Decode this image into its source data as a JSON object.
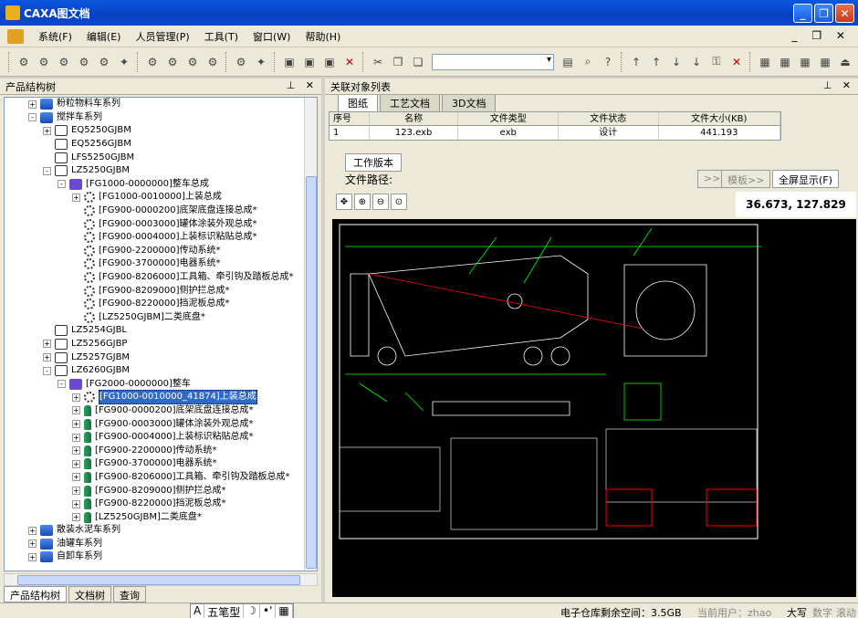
{
  "window": {
    "title": "CAXA图文档"
  },
  "menu": [
    "系统(F)",
    "编辑(E)",
    "人员管理(P)",
    "工具(T)",
    "窗口(W)",
    "帮助(H)"
  ],
  "left_panel": {
    "title": "产品结构树",
    "tree": [
      {
        "indent": 1,
        "exp": "+",
        "icon": "folder",
        "label": "粉粒物料车系列"
      },
      {
        "indent": 1,
        "exp": "-",
        "icon": "folder",
        "label": "搅拌车系列"
      },
      {
        "indent": 2,
        "exp": "+",
        "icon": "assy",
        "label": "EQ5250GJBM"
      },
      {
        "indent": 2,
        "exp": "",
        "icon": "assy",
        "label": "EQ5256GJBM"
      },
      {
        "indent": 2,
        "exp": "",
        "icon": "assy",
        "label": "LFS5250GJBM"
      },
      {
        "indent": 2,
        "exp": "-",
        "icon": "assy",
        "label": "LZ5250GJBM"
      },
      {
        "indent": 3,
        "exp": "-",
        "icon": "root",
        "label": "[FG1000-0000000]整车总成"
      },
      {
        "indent": 4,
        "exp": "+",
        "icon": "gear",
        "label": "[FG1000-0010000]上装总成"
      },
      {
        "indent": 4,
        "exp": "",
        "icon": "gear",
        "label": "[FG900-0000200]底架底盘连接总成*"
      },
      {
        "indent": 4,
        "exp": "",
        "icon": "gear",
        "label": "[FG900-0003000]罐体涂装外观总成*"
      },
      {
        "indent": 4,
        "exp": "",
        "icon": "gear",
        "label": "[FG900-0004000]上装标识粘贴总成*"
      },
      {
        "indent": 4,
        "exp": "",
        "icon": "gear",
        "label": "[FG900-2200000]传动系统*"
      },
      {
        "indent": 4,
        "exp": "",
        "icon": "gear",
        "label": "[FG900-3700000]电器系统*"
      },
      {
        "indent": 4,
        "exp": "",
        "icon": "gear",
        "label": "[FG900-8206000]工具箱、牵引钩及踏板总成*"
      },
      {
        "indent": 4,
        "exp": "",
        "icon": "gear",
        "label": "[FG900-8209000]侧护拦总成*"
      },
      {
        "indent": 4,
        "exp": "",
        "icon": "gear",
        "label": "[FG900-8220000]挡泥板总成*"
      },
      {
        "indent": 4,
        "exp": "",
        "icon": "gear",
        "label": "[LZ5250GJBM]二类底盘*"
      },
      {
        "indent": 2,
        "exp": "",
        "icon": "assy",
        "label": "LZ5254GJBL"
      },
      {
        "indent": 2,
        "exp": "+",
        "icon": "assy",
        "label": "LZ5256GJBP"
      },
      {
        "indent": 2,
        "exp": "+",
        "icon": "assy",
        "label": "LZ5257GJBM"
      },
      {
        "indent": 2,
        "exp": "-",
        "icon": "assy",
        "label": "LZ6260GJBM"
      },
      {
        "indent": 3,
        "exp": "-",
        "icon": "root",
        "label": "[FG2000-0000000]整车"
      },
      {
        "indent": 4,
        "exp": "+",
        "icon": "gear",
        "label": "[FG1000-0010000_41874]上装总成",
        "selected": true
      },
      {
        "indent": 4,
        "exp": "+",
        "icon": "pin",
        "label": "[FG900-0000200]底架底盘连接总成*"
      },
      {
        "indent": 4,
        "exp": "+",
        "icon": "pin",
        "label": "[FG900-0003000]罐体涂装外观总成*"
      },
      {
        "indent": 4,
        "exp": "+",
        "icon": "pin",
        "label": "[FG900-0004000]上装标识粘贴总成*"
      },
      {
        "indent": 4,
        "exp": "+",
        "icon": "pin",
        "label": "[FG900-2200000]传动系统*"
      },
      {
        "indent": 4,
        "exp": "+",
        "icon": "pin",
        "label": "[FG900-3700000]电器系统*"
      },
      {
        "indent": 4,
        "exp": "+",
        "icon": "pin",
        "label": "[FG900-8206000]工具箱、牵引钩及踏板总成*"
      },
      {
        "indent": 4,
        "exp": "+",
        "icon": "pin",
        "label": "[FG900-8209000]侧护拦总成*"
      },
      {
        "indent": 4,
        "exp": "+",
        "icon": "pin",
        "label": "[FG900-8220000]挡泥板总成*"
      },
      {
        "indent": 4,
        "exp": "+",
        "icon": "pin",
        "label": "[LZ5250GJBM]二类底盘*"
      },
      {
        "indent": 1,
        "exp": "+",
        "icon": "folder",
        "label": "散装水泥车系列"
      },
      {
        "indent": 1,
        "exp": "+",
        "icon": "folder",
        "label": "油罐车系列"
      },
      {
        "indent": 1,
        "exp": "+",
        "icon": "folder",
        "label": "自卸车系列"
      }
    ],
    "bottom_tabs": [
      "产品结构树",
      "文档树",
      "查询"
    ]
  },
  "right_panel": {
    "title": "关联对象列表",
    "tabs": [
      "图纸",
      "工艺文档",
      "3D文档"
    ],
    "columns": [
      "序号",
      "名称",
      "文件类型",
      "文件状态",
      "文件大小(KB)"
    ],
    "rows": [
      [
        "1",
        "123.exb",
        "exb",
        "设计",
        "441.193"
      ]
    ],
    "work_tab": "工作版本",
    "file_path_label": "文件路径:",
    "btn_next": ">>",
    "btn_template": "模板>>",
    "btn_fullscreen": "全屏显示(F)",
    "coords": "36.673, 127.829"
  },
  "status": {
    "ime": [
      "A",
      "五笔型",
      "☽",
      "•'",
      "▦"
    ],
    "space": "电子仓库剩余空间：3.5GB",
    "user": "当前用户：zhao",
    "caps": "大写",
    "num": "数字",
    "scroll": "滚动"
  }
}
